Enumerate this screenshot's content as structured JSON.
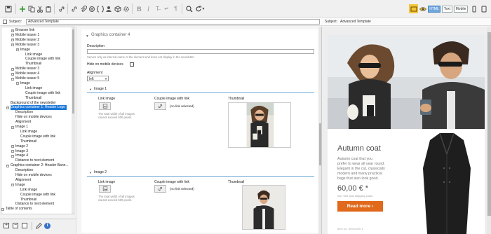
{
  "toolbar": {
    "icons": [
      "save-icon",
      "add-icon",
      "copy-icon",
      "cut-icon",
      "paste-icon",
      "link-icon",
      "link-icon",
      "attachment-icon",
      "at-icon",
      "placeholder-icon",
      "person-icon",
      "box-icon",
      "gear-icon",
      "bold-icon",
      "italic-icon",
      "clear-format-icon",
      "line-break-icon",
      "pilcrow-icon",
      "search-icon",
      "refresh-icon"
    ],
    "view_buttons": [
      "HTML",
      "Text",
      "Mobile"
    ]
  },
  "subject": {
    "label": "Subject:",
    "value": "Advanced Template",
    "right_label": "Subject:",
    "right_value": "Advanced Template"
  },
  "tree": {
    "items": [
      {
        "label": "Browser link",
        "indent": 2,
        "toggle": "+"
      },
      {
        "label": "Mobile teaser 1",
        "indent": 2,
        "toggle": "+"
      },
      {
        "label": "Mobile teaser 2",
        "indent": 2,
        "toggle": "+"
      },
      {
        "label": "Mobile teaser 3",
        "indent": 2,
        "toggle": "-"
      },
      {
        "label": "Image",
        "indent": 3,
        "toggle": "-"
      },
      {
        "label": "Link image",
        "indent": 4
      },
      {
        "label": "Couple image with link",
        "indent": 4
      },
      {
        "label": "Thumbnail",
        "indent": 4
      },
      {
        "label": "Mobile teaser 3",
        "indent": 2,
        "toggle": "+"
      },
      {
        "label": "Mobile teaser 4",
        "indent": 2,
        "toggle": "+"
      },
      {
        "label": "Mobile teaser 5",
        "indent": 2,
        "toggle": "-"
      },
      {
        "label": "Image",
        "indent": 3,
        "toggle": "-"
      },
      {
        "label": "Link image",
        "indent": 4
      },
      {
        "label": "Couple image with link",
        "indent": 4
      },
      {
        "label": "Thumbnail",
        "indent": 4
      },
      {
        "label": "Background of the newsletter",
        "indent": 1
      },
      {
        "label": "Graphics container 1: Header Logo",
        "indent": 1,
        "toggle": "-",
        "selected": true
      },
      {
        "label": "Description",
        "indent": 2
      },
      {
        "label": "Hide on mobile devices",
        "indent": 2
      },
      {
        "label": "Alignment",
        "indent": 2
      },
      {
        "label": "Image 1",
        "indent": 2,
        "toggle": "-"
      },
      {
        "label": "Link image",
        "indent": 3
      },
      {
        "label": "Couple image with link",
        "indent": 3
      },
      {
        "label": "Thumbnail",
        "indent": 3
      },
      {
        "label": "Image 2",
        "indent": 2,
        "toggle": "+"
      },
      {
        "label": "Image 3",
        "indent": 2,
        "toggle": "+"
      },
      {
        "label": "Image 4",
        "indent": 2,
        "toggle": "+"
      },
      {
        "label": "Distance to next element",
        "indent": 2
      },
      {
        "label": "Graphics container 2: Header Bann...",
        "indent": 1,
        "toggle": "-"
      },
      {
        "label": "Description",
        "indent": 2
      },
      {
        "label": "Hide on mobile devices",
        "indent": 2
      },
      {
        "label": "Alignment",
        "indent": 2
      },
      {
        "label": "Image",
        "indent": 2,
        "toggle": "-"
      },
      {
        "label": "Link image",
        "indent": 3
      },
      {
        "label": "Couple image with link",
        "indent": 3
      },
      {
        "label": "Thumbnail",
        "indent": 3
      },
      {
        "label": "Distance to next element",
        "indent": 2
      },
      {
        "label": "Table of contents",
        "indent": 0,
        "toggle": "+"
      }
    ]
  },
  "editor": {
    "section_title": "Graphics container 4",
    "description_label": "Description",
    "description_hint": "Serves only as internal name of the element and does not display in the newsletter",
    "hide_mobile_label": "Hide on mobile devices",
    "alignment_label": "Alignment",
    "alignment_value": "left",
    "image1": {
      "title": "Image 1",
      "link_image_label": "Link image",
      "couple_label": "Couple image with link",
      "thumbnail_label": "Thumbnail",
      "size_hint_1": "The total width of all images",
      "size_hint_2": "cannot exceed 600 pixels.",
      "link_status": "(no link selected)"
    },
    "image2": {
      "title": "Image 2",
      "link_image_label": "Link image",
      "couple_label": "Couple image with link",
      "thumbnail_label": "Thumbnail",
      "size_hint_1": "The total width of all images",
      "size_hint_2": "cannot exceed 600 pixels.",
      "link_status": "(no link selected)"
    }
  },
  "preview": {
    "heading": "Autumn coat",
    "body": "Lorem ipsum dolor sit amet that you prefer to wear all year round. Elegant in the cut, classically modern and many practical bags that also look good.",
    "body_lines": [
      "Autumn coat that you",
      "prefer to wear all year round.",
      "Elegant in the cut, classically",
      "modern and many practical",
      "bags that also look good."
    ],
    "price": "60,00 € *",
    "price_note": "incl. VAT plus shipping costs",
    "button": "Read more ›",
    "footer_text": "Item no. SW10009.1"
  },
  "colors": {
    "accent": "#1e78d8",
    "cta": "#e0691c",
    "heading": "#4a4a4a"
  }
}
